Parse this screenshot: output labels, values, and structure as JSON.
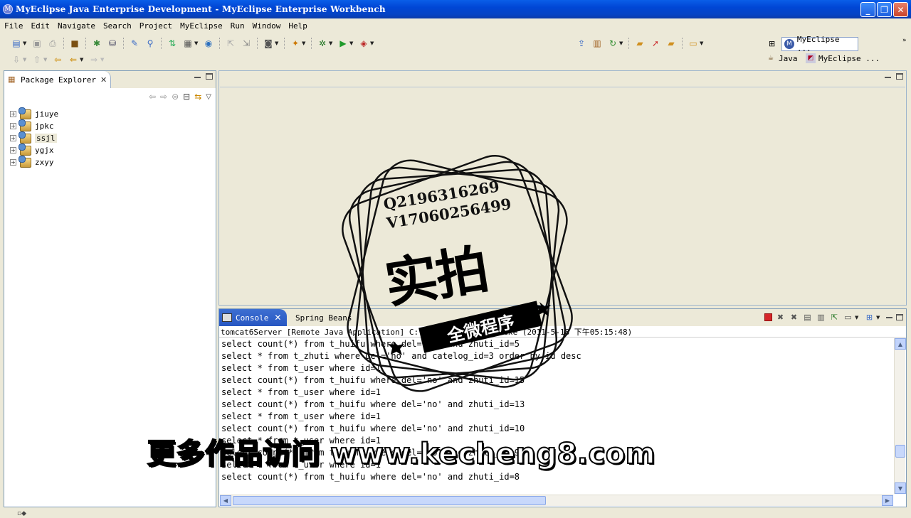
{
  "window": {
    "title": "MyEclipse Java Enterprise Development - MyEclipse Enterprise Workbench",
    "controls": {
      "minimize": "_",
      "maximize": "❐",
      "close": "✕"
    }
  },
  "menu": [
    "File",
    "Edit",
    "Navigate",
    "Search",
    "Project",
    "MyEclipse",
    "Run",
    "Window",
    "Help"
  ],
  "perspectives": {
    "active": "MyEclipse ...",
    "items": [
      "Java",
      "MyEclipse ..."
    ]
  },
  "package_explorer": {
    "title": "Package Explorer",
    "projects": [
      {
        "name": "jiuye",
        "selected": false
      },
      {
        "name": "jpkc",
        "selected": false
      },
      {
        "name": "ssjl",
        "selected": true
      },
      {
        "name": "ygjx",
        "selected": false
      },
      {
        "name": "zxyy",
        "selected": false
      }
    ]
  },
  "console": {
    "tabs": [
      "Console",
      "Spring Beans"
    ],
    "description": "tomcat6Server [Remote Java Application] C:\\Pr                                 _05\\bin\\javaw.exe (2011-5-18 下午05:15:48)",
    "lines": [
      "select count(*) from t_huifu where del='no' and zhuti_id=5",
      "select * from t_zhuti where del='no' and catelog_id=3 order by id desc",
      "select * from t_user where id=1",
      "select count(*) from t_huifu where del='no' and zhuti_id=15",
      "select * from t_user where id=1",
      "select count(*) from t_huifu where del='no' and zhuti_id=13",
      "select * from t_user where id=1",
      "select count(*) from t_huifu where del='no' and zhuti_id=10",
      "select * from t_user where id=1",
      "select count(*) from t_huifu where del='no' and zhuti_id=9",
      "select * from t_user where id=1",
      "select count(*) from t_huifu where del='no' and zhuti_id=8"
    ]
  },
  "watermark": {
    "contact_q": "Q2196316269",
    "contact_v": "V17060256499",
    "main": "实拍",
    "ribbon": "全微程序"
  },
  "subtitle": "更多作品访问 www.kecheng8.com",
  "colors": {
    "title_bar": "#0046d5",
    "active_tab": "#2757c2",
    "stop_button": "#d6262a"
  }
}
